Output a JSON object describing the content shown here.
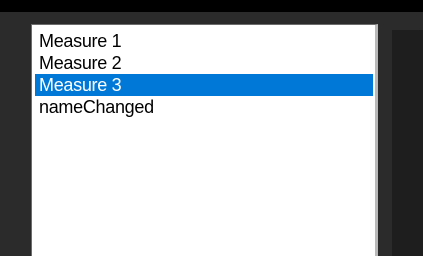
{
  "listbox": {
    "items": [
      {
        "label": "Measure 1",
        "selected": false
      },
      {
        "label": "Measure 2",
        "selected": false
      },
      {
        "label": "Measure 3",
        "selected": true
      },
      {
        "label": "nameChanged",
        "selected": false
      }
    ]
  },
  "colors": {
    "selection": "#0078d7",
    "background": "#2b2b2b"
  }
}
